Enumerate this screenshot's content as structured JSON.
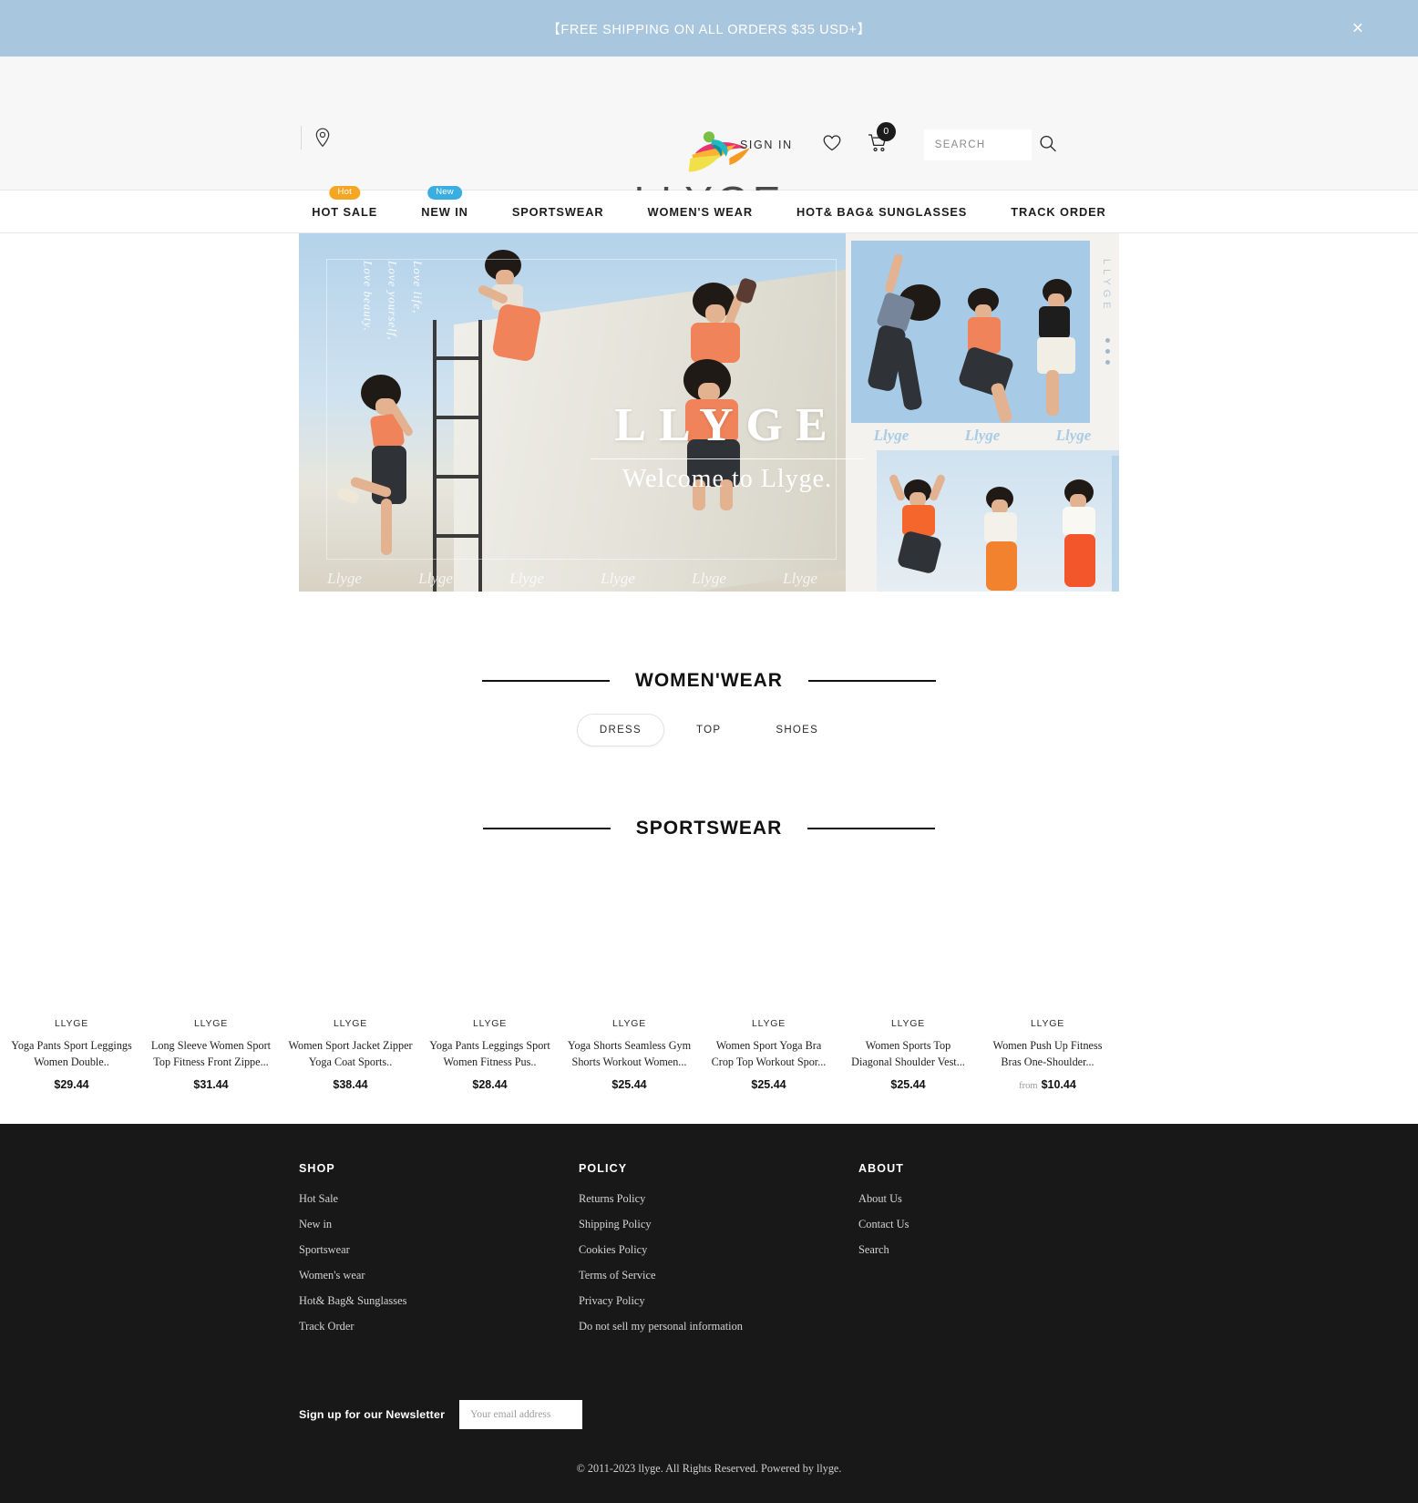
{
  "announcement": {
    "text": "【FREE SHIPPING ON ALL ORDERS $35 USD+】",
    "close_label": "×"
  },
  "header": {
    "location_icon": "location-pin-icon",
    "logo_word": "LLYGE",
    "sign_in": "SIGN IN",
    "wishlist_icon": "heart-icon",
    "cart_icon": "shopping-cart-icon",
    "cart_count": "0",
    "search": {
      "placeholder": "SEARCH",
      "value": "",
      "icon": "search-icon"
    }
  },
  "nav": {
    "items": [
      {
        "label": "HOT SALE",
        "badge": "Hot",
        "badge_type": "hot"
      },
      {
        "label": "NEW IN",
        "badge": "New",
        "badge_type": "new"
      },
      {
        "label": "SPORTSWEAR",
        "badge": "",
        "badge_type": ""
      },
      {
        "label": "WOMEN'S WEAR",
        "badge": "",
        "badge_type": ""
      },
      {
        "label": "HOT& BAG& SUNGLASSES",
        "badge": "",
        "badge_type": ""
      },
      {
        "label": "TRACK ORDER",
        "badge": "",
        "badge_type": ""
      }
    ]
  },
  "hero": {
    "vertical_tagline": "Love life,\nLove yourself,\nLove beauty.",
    "brand_big": "LLYGE",
    "welcome": "Welcome to Llyge.",
    "watermark": "Llyge",
    "side_brand": "LLYGE",
    "dots": 3
  },
  "womenswear": {
    "title": "WOMEN'WEAR",
    "tabs": [
      {
        "label": "DRESS",
        "active": true
      },
      {
        "label": "TOP",
        "active": false
      },
      {
        "label": "SHOES",
        "active": false
      }
    ]
  },
  "sportswear": {
    "title": "SPORTSWEAR",
    "products": [
      {
        "brand": "LLYGE",
        "title": "Yoga Pants Sport Leggings Women Double..",
        "price": "$29.44",
        "from": ""
      },
      {
        "brand": "LLYGE",
        "title": "Long Sleeve Women Sport Top Fitness Front Zippe...",
        "price": "$31.44",
        "from": ""
      },
      {
        "brand": "LLYGE",
        "title": "Women Sport Jacket Zipper Yoga Coat Sports..",
        "price": "$38.44",
        "from": ""
      },
      {
        "brand": "LLYGE",
        "title": "Yoga Pants Leggings Sport Women Fitness Pus..",
        "price": "$28.44",
        "from": ""
      },
      {
        "brand": "LLYGE",
        "title": "Yoga Shorts Seamless Gym Shorts Workout Women...",
        "price": "$25.44",
        "from": ""
      },
      {
        "brand": "LLYGE",
        "title": "Women Sport Yoga Bra Crop Top Workout Spor...",
        "price": "$25.44",
        "from": ""
      },
      {
        "brand": "LLYGE",
        "title": "Women Sports Top Diagonal Shoulder Vest...",
        "price": "$25.44",
        "from": ""
      },
      {
        "brand": "LLYGE",
        "title": "Women Push Up Fitness Bras One-Shoulder...",
        "price": "$10.44",
        "from": "from"
      }
    ]
  },
  "footer": {
    "columns": [
      {
        "title": "SHOP",
        "links": [
          "Hot Sale",
          "New in",
          "Sportswear",
          "Women's wear",
          "Hot& Bag& Sunglasses",
          "Track Order"
        ]
      },
      {
        "title": "POLICY",
        "links": [
          "Returns Policy",
          "Shipping Policy",
          "Cookies Policy",
          "Terms of Service",
          "Privacy Policy",
          "Do not sell my personal information"
        ]
      },
      {
        "title": "ABOUT",
        "links": [
          "About Us",
          "Contact Us",
          "Search"
        ]
      }
    ],
    "newsletter": {
      "label": "Sign up for our Newsletter",
      "placeholder": "Your email address",
      "value": ""
    },
    "copyright": "© 2011-2023 llyge. All Rights Reserved. Powered by llyge."
  },
  "colors": {
    "announce_bg": "#a8c6de",
    "badge_hot": "#f5a623",
    "badge_new": "#3aaee0",
    "footer_bg": "#181818",
    "logo_text": "#4a4a4a"
  }
}
